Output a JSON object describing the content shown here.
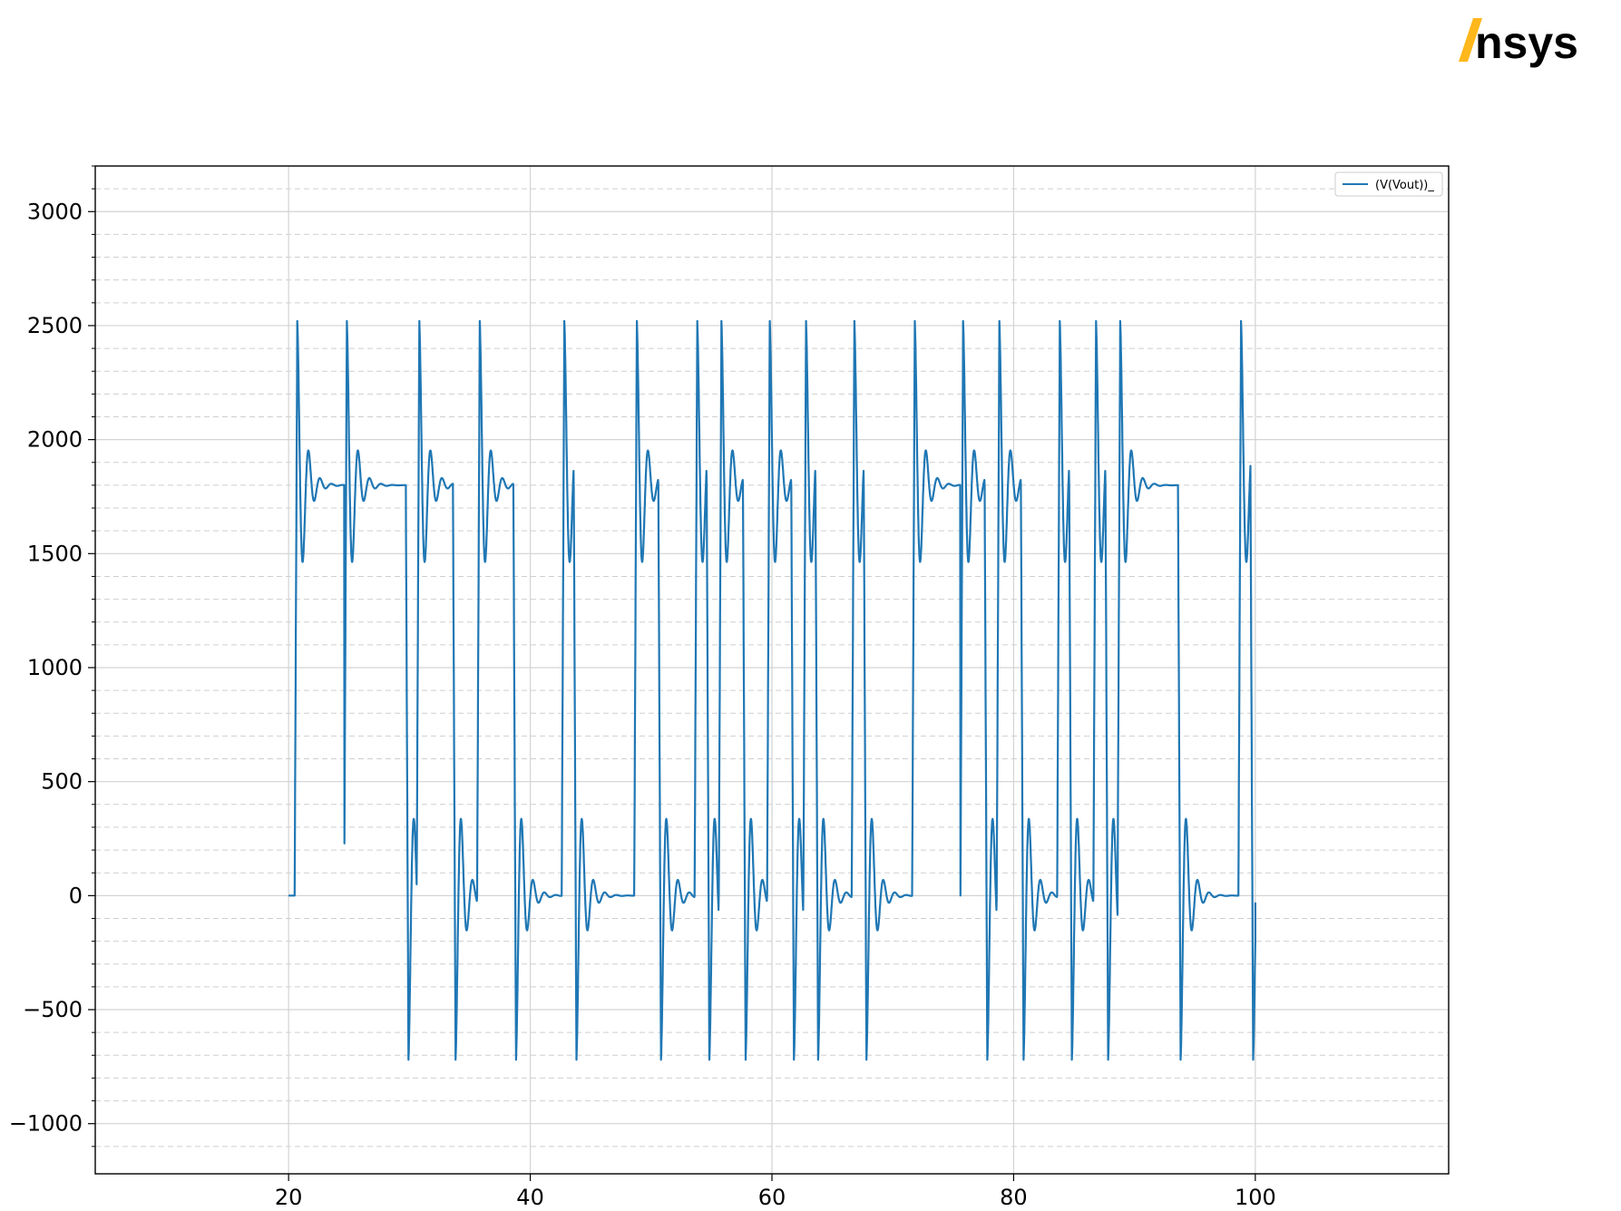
{
  "brand": {
    "name": "Ansys",
    "accent_color": "#FFB71B",
    "text_color": "#000000"
  },
  "chart_data": {
    "type": "line",
    "title": "",
    "xlabel": "",
    "ylabel": "",
    "xlim": [
      4,
      116
    ],
    "ylim": [
      -1220,
      3200
    ],
    "x_ticks": [
      20,
      40,
      60,
      80,
      100
    ],
    "x_tick_labels": [
      "20",
      "40",
      "60",
      "80",
      "100"
    ],
    "y_ticks": [
      -1000,
      -500,
      0,
      500,
      1000,
      1500,
      2000,
      2500,
      3000
    ],
    "y_tick_labels": [
      "−1000",
      "−500",
      "0",
      "500",
      "1000",
      "1500",
      "2000",
      "2500",
      "3000"
    ],
    "grid": {
      "major": true,
      "minor_y": true,
      "major_style": "solid",
      "minor_style": "dashed"
    },
    "legend": {
      "position": "top-right"
    },
    "series": [
      {
        "name": "(V(Vout))_",
        "color": "#1f77b4",
        "x_range": [
          20,
          100
        ],
        "high_level": 1800,
        "low_level": 0,
        "transitions": [
          {
            "t": 20.5,
            "dir": "up"
          },
          {
            "t": 24.6,
            "dir": "up"
          },
          {
            "t": 29.7,
            "dir": "down"
          },
          {
            "t": 30.6,
            "dir": "up"
          },
          {
            "t": 33.6,
            "dir": "down"
          },
          {
            "t": 35.6,
            "dir": "up"
          },
          {
            "t": 38.6,
            "dir": "down"
          },
          {
            "t": 42.6,
            "dir": "up"
          },
          {
            "t": 43.6,
            "dir": "down"
          },
          {
            "t": 48.6,
            "dir": "up"
          },
          {
            "t": 50.6,
            "dir": "down"
          },
          {
            "t": 53.6,
            "dir": "up"
          },
          {
            "t": 54.6,
            "dir": "down"
          },
          {
            "t": 55.6,
            "dir": "up"
          },
          {
            "t": 57.6,
            "dir": "down"
          },
          {
            "t": 59.6,
            "dir": "up"
          },
          {
            "t": 61.6,
            "dir": "down"
          },
          {
            "t": 62.6,
            "dir": "up"
          },
          {
            "t": 63.6,
            "dir": "down"
          },
          {
            "t": 66.6,
            "dir": "up"
          },
          {
            "t": 67.6,
            "dir": "down"
          },
          {
            "t": 71.6,
            "dir": "up"
          },
          {
            "t": 75.6,
            "dir": "down"
          },
          {
            "t": 75.6,
            "dir": "up"
          },
          {
            "t": 77.6,
            "dir": "down"
          },
          {
            "t": 78.6,
            "dir": "up"
          },
          {
            "t": 80.6,
            "dir": "down"
          },
          {
            "t": 83.6,
            "dir": "up"
          },
          {
            "t": 84.6,
            "dir": "down"
          },
          {
            "t": 86.6,
            "dir": "up"
          },
          {
            "t": 87.6,
            "dir": "down"
          },
          {
            "t": 88.6,
            "dir": "up"
          },
          {
            "t": 93.6,
            "dir": "down"
          },
          {
            "t": 98.6,
            "dir": "up"
          },
          {
            "t": 99.6,
            "dir": "down"
          }
        ],
        "overshoot": 720,
        "damping": 0.6,
        "ring_period": 0.95,
        "end_value": -30
      }
    ]
  }
}
